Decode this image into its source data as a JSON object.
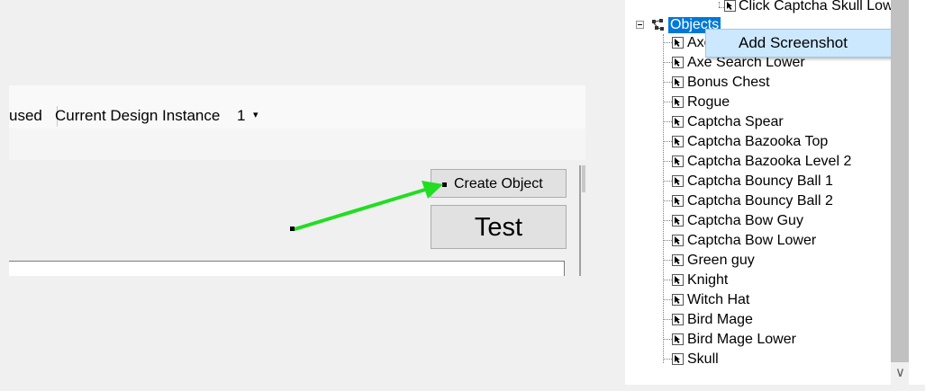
{
  "toolbar": {
    "used_fragment": "used",
    "design_instance_label": "Current Design Instance",
    "design_instance_value": "1",
    "dropdown_glyph": "▾"
  },
  "buttons": {
    "create_object": "Create Object",
    "test": "Test"
  },
  "annotation": {
    "arrow_color": "#22dd22"
  },
  "tree": {
    "top_item": "Click Captcha Skull Low",
    "objects_label": "Objects",
    "objects_partial_first": "Axe",
    "items": [
      "Axe Search Lower",
      "Bonus Chest",
      "Rogue",
      "Captcha Spear",
      "Captcha Bazooka Top",
      "Captcha Bazooka Level 2",
      "Captcha Bouncy Ball 1",
      "Captcha Bouncy Ball 2",
      "Captcha Bow Guy",
      "Captcha Bow Lower",
      "Green guy",
      "Knight",
      "Witch Hat",
      "Bird Mage",
      "Bird Mage Lower",
      "Skull"
    ],
    "item_icon": "cursor-arrow-icon",
    "scroll_down_glyph": "∨"
  },
  "context_menu": {
    "items": [
      "Add Screenshot"
    ]
  },
  "colors": {
    "selection": "#0078d7",
    "menu_highlight": "#cce8ff"
  }
}
